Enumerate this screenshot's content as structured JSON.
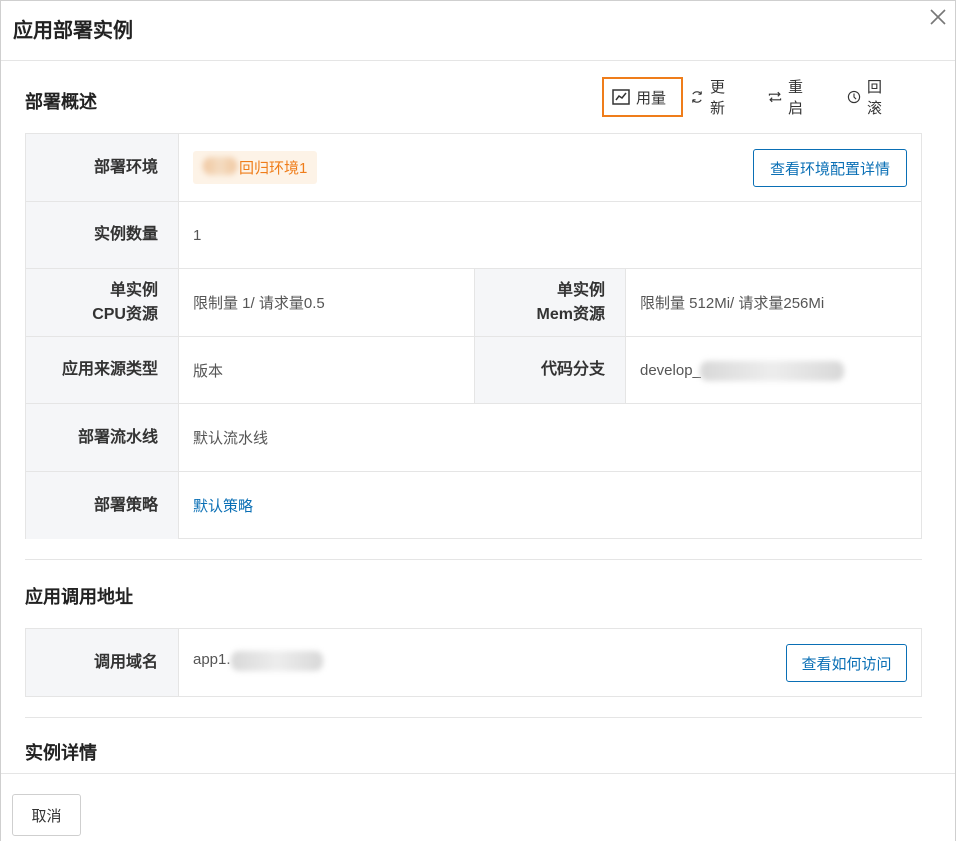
{
  "dialog": {
    "title": "应用部署实例"
  },
  "overview": {
    "title": "部署概述",
    "toolbar": {
      "usage": "用量",
      "update": "更新",
      "restart": "重启",
      "rollback": "回滚"
    },
    "rows": {
      "env": {
        "label": "部署环境",
        "value": "回归环境1",
        "button": "查看环境配置详情"
      },
      "count": {
        "label": "实例数量",
        "value": "1"
      },
      "cpu": {
        "label_line1": "单实例",
        "label_line2": "CPU资源",
        "value": "限制量 1/ 请求量0.5"
      },
      "mem": {
        "label_line1": "单实例",
        "label_line2": "Mem资源",
        "value": "限制量 512Mi/ 请求量256Mi"
      },
      "source": {
        "label": "应用来源类型",
        "value": "版本"
      },
      "branch": {
        "label": "代码分支",
        "value": "develop_"
      },
      "pipeline": {
        "label": "部署流水线",
        "value": "默认流水线"
      },
      "strategy": {
        "label": "部署策略",
        "value": "默认策略"
      }
    }
  },
  "invoke": {
    "title": "应用调用地址",
    "domain": {
      "label": "调用域名",
      "value": "app1.",
      "button": "查看如何访问"
    }
  },
  "details": {
    "title": "实例详情"
  },
  "footer": {
    "cancel": "取消"
  },
  "colors": {
    "accent": "#0a6fb5",
    "highlight": "#ef7d1a",
    "label_bg": "#f5f6f8"
  }
}
